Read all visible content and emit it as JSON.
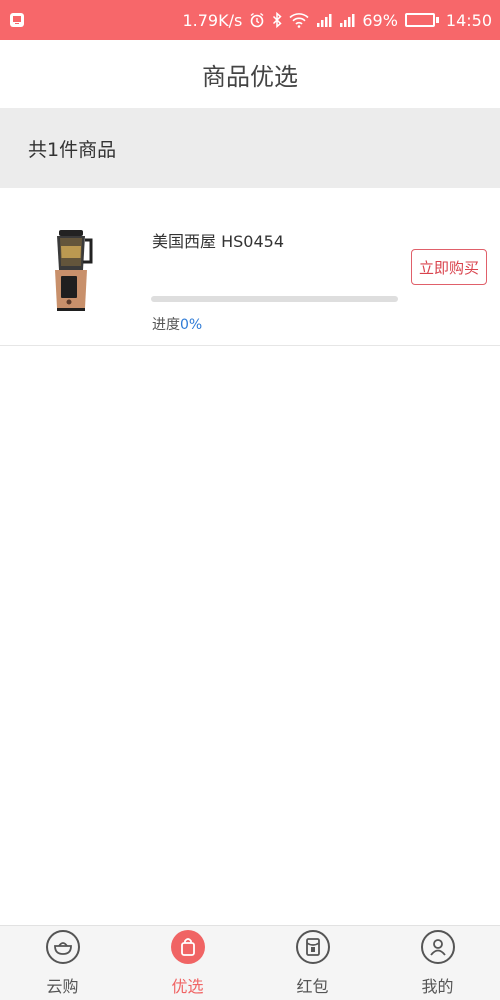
{
  "status_bar": {
    "speed": "1.79K/s",
    "battery_percent": "69%",
    "battery_level": 0.69,
    "time": "14:50"
  },
  "header": {
    "title": "商品优选"
  },
  "summary": {
    "count_text": "共1件商品"
  },
  "products": [
    {
      "name": "美国西屋 HS0454",
      "image_icon": "blender-product-image",
      "progress_label": "进度",
      "progress_percent": "0%",
      "progress_value": 0,
      "buy_label": "立即购买"
    }
  ],
  "tabs": [
    {
      "label": "云购",
      "icon": "pot-icon",
      "active": false
    },
    {
      "label": "优选",
      "icon": "bag-icon",
      "active": true
    },
    {
      "label": "红包",
      "icon": "envelope-icon",
      "active": false
    },
    {
      "label": "我的",
      "icon": "user-icon",
      "active": false
    }
  ],
  "colors": {
    "status_bar": "#f7676a",
    "accent": "#f06464",
    "progress": "#2e7bd6",
    "buy_border": "#e0606a"
  }
}
